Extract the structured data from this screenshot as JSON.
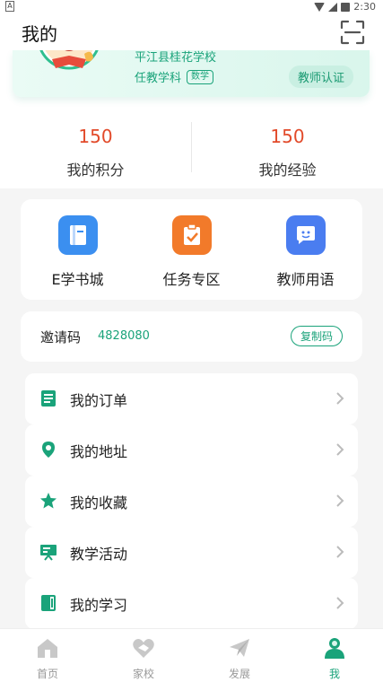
{
  "statusbar": {
    "time": "2:30",
    "left_glyph": "A"
  },
  "header": {
    "title": "我的"
  },
  "profile": {
    "school": "平江县桂花学校",
    "subject_prefix": "任教学科",
    "subject": "数学",
    "cert_button": "教师认证"
  },
  "stats": [
    {
      "value": "150",
      "label": "我的积分"
    },
    {
      "value": "150",
      "label": "我的经验"
    }
  ],
  "tools": [
    {
      "label": "E学书城",
      "icon": "book-icon",
      "color": "#3b8ff0"
    },
    {
      "label": "任务专区",
      "icon": "task-clipboard-icon",
      "color": "#f27a2a"
    },
    {
      "label": "教师用语",
      "icon": "chat-face-icon",
      "color": "#4a7df0"
    }
  ],
  "invite": {
    "label": "邀请码",
    "code": "4828080",
    "copy_button": "复制码"
  },
  "menu": [
    {
      "label": "我的订单",
      "icon": "order-list-icon"
    },
    {
      "label": "我的地址",
      "icon": "location-pin-icon"
    },
    {
      "label": "我的收藏",
      "icon": "star-icon"
    },
    {
      "label": "教学活动",
      "icon": "presentation-icon"
    },
    {
      "label": "我的学习",
      "icon": "notebook-icon"
    }
  ],
  "tabbar": [
    {
      "label": "首页",
      "icon": "home-icon",
      "active": false
    },
    {
      "label": "家校",
      "icon": "handshake-heart-icon",
      "active": false
    },
    {
      "label": "发展",
      "icon": "paper-plane-icon",
      "active": false
    },
    {
      "label": "我",
      "icon": "user-icon",
      "active": true
    }
  ],
  "colors": {
    "accent": "#1aa37a",
    "stat_value": "#e24a2a"
  }
}
